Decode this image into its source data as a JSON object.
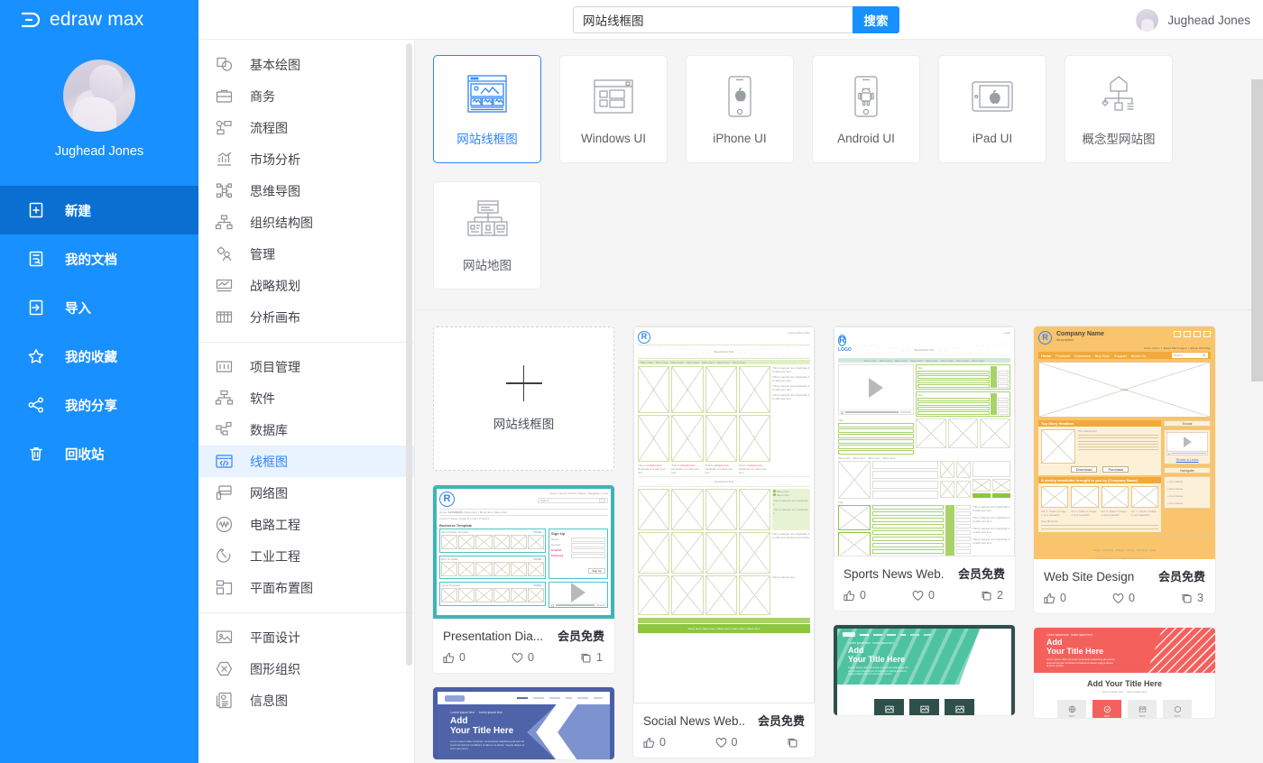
{
  "brand": {
    "name": "edraw max",
    "logo_icon": "edraw-logo-icon"
  },
  "sidebar": {
    "profile": {
      "name": "Jughead Jones",
      "avatar_icon": "user-avatar"
    },
    "items": [
      {
        "label": "新建",
        "icon": "new-document-icon",
        "active": true
      },
      {
        "label": "我的文档",
        "icon": "my-documents-icon",
        "active": false
      },
      {
        "label": "导入",
        "icon": "import-icon",
        "active": false
      },
      {
        "label": "我的收藏",
        "icon": "star-icon",
        "active": false
      },
      {
        "label": "我的分享",
        "icon": "share-icon",
        "active": false
      },
      {
        "label": "回收站",
        "icon": "trash-icon",
        "active": false
      }
    ]
  },
  "categories": {
    "groups": [
      {
        "items": [
          {
            "label": "基本绘图",
            "icon": "basic-shapes-icon",
            "active": false
          },
          {
            "label": "商务",
            "icon": "briefcase-icon",
            "active": false
          },
          {
            "label": "流程图",
            "icon": "flowchart-icon",
            "active": false
          },
          {
            "label": "市场分析",
            "icon": "bar-chart-icon",
            "active": false
          },
          {
            "label": "思维导图",
            "icon": "mindmap-icon",
            "active": false
          },
          {
            "label": "组织结构图",
            "icon": "org-chart-icon",
            "active": false
          },
          {
            "label": "管理",
            "icon": "management-icon",
            "active": false
          },
          {
            "label": "战略规划",
            "icon": "strategy-icon",
            "active": false
          },
          {
            "label": "分析画布",
            "icon": "canvas-icon",
            "active": false
          }
        ]
      },
      {
        "items": [
          {
            "label": "项目管理",
            "icon": "project-icon",
            "active": false
          },
          {
            "label": "软件",
            "icon": "software-icon",
            "active": false
          },
          {
            "label": "数据库",
            "icon": "database-icon",
            "active": false
          },
          {
            "label": "线框图",
            "icon": "wireframe-icon",
            "active": true
          },
          {
            "label": "网络图",
            "icon": "network-icon",
            "active": false
          },
          {
            "label": "电路工程",
            "icon": "circuit-icon",
            "active": false
          },
          {
            "label": "工业工程",
            "icon": "industrial-icon",
            "active": false
          },
          {
            "label": "平面布置图",
            "icon": "floorplan-icon",
            "active": false
          }
        ]
      },
      {
        "items": [
          {
            "label": "平面设计",
            "icon": "graphic-design-icon",
            "active": false
          },
          {
            "label": "图形组织",
            "icon": "graphic-organizer-icon",
            "active": false
          },
          {
            "label": "信息图",
            "icon": "infographic-icon",
            "active": false
          }
        ]
      }
    ]
  },
  "topbar": {
    "search": {
      "value": "网站线框图",
      "placeholder": "",
      "button_label": "搜索",
      "icon": "search-icon"
    },
    "user": {
      "name": "Jughead Jones",
      "avatar_icon": "user-avatar-small"
    }
  },
  "types": {
    "row1": [
      {
        "label": "网站线框图",
        "icon": "website-wireframe-icon",
        "selected": true
      },
      {
        "label": "Windows UI",
        "icon": "windows-ui-icon",
        "selected": false
      },
      {
        "label": "iPhone UI",
        "icon": "iphone-ui-icon",
        "selected": false
      },
      {
        "label": "Android UI",
        "icon": "android-ui-icon",
        "selected": false
      },
      {
        "label": "iPad UI",
        "icon": "ipad-ui-icon",
        "selected": false
      },
      {
        "label": "概念型网站图",
        "icon": "conceptual-website-icon",
        "selected": false
      }
    ],
    "row2": [
      {
        "label": "网站地图",
        "icon": "sitemap-icon",
        "selected": false
      }
    ]
  },
  "gallery": {
    "new_card": {
      "label": "网站线框图",
      "icon": "plus-icon"
    },
    "badge_label": "会员免费",
    "stat_icons": {
      "like": "thumbs-up-icon",
      "favorite": "heart-icon",
      "copies": "copy-icon"
    },
    "columns": [
      {
        "cards": [
          {
            "title": "Presentation Dia...",
            "badge": "会员免费",
            "likes": "0",
            "favorites": "0",
            "copies": "1",
            "accent": "#3db5b5",
            "thumb_height": 148
          },
          {
            "title": "",
            "badge": "",
            "likes": "",
            "favorites": "",
            "copies": "",
            "accent": "#4a5fa5",
            "thumb_height": 80
          }
        ]
      },
      {
        "cards": [
          {
            "title": "Social News Web...",
            "badge": "会员免费",
            "likes": "0",
            "favorites": "0",
            "copies": "",
            "accent": "#8cc63f",
            "thumb_height": 418
          }
        ]
      },
      {
        "cards": [
          {
            "title": "Sports News Web...",
            "badge": "会员免费",
            "likes": "0",
            "favorites": "0",
            "copies": "2",
            "accent": "#8cc63f",
            "thumb_height": 255
          },
          {
            "title": "",
            "badge": "",
            "likes": "",
            "favorites": "",
            "copies": "",
            "accent": "#49bfa5",
            "thumb_height": 100
          }
        ]
      },
      {
        "cards": [
          {
            "title": "Web Site Design",
            "badge": "会员免费",
            "likes": "0",
            "favorites": "0",
            "copies": "3",
            "accent": "#f9c46b",
            "thumb_height": 258
          },
          {
            "title": "",
            "badge": "",
            "likes": "",
            "favorites": "",
            "copies": "",
            "accent": "#f4605c",
            "thumb_height": 100
          }
        ]
      }
    ]
  },
  "colors": {
    "brand_blue": "#1890ff",
    "active_nav": "#0a6fd1",
    "accent_text": "#2f86f6",
    "page_bg": "#f5f5f5"
  }
}
